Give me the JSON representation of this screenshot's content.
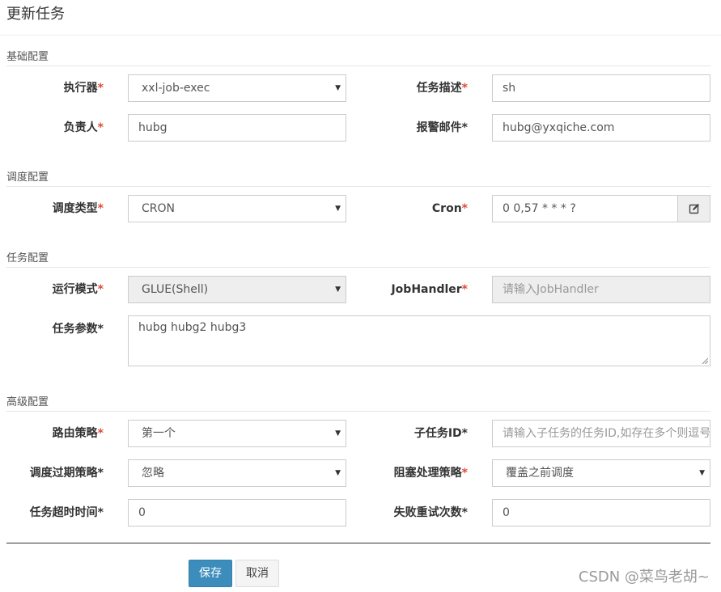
{
  "dialog": {
    "title": "更新任务"
  },
  "sections": {
    "basic": "基础配置",
    "schedule": "调度配置",
    "task": "任务配置",
    "advanced": "高级配置"
  },
  "basic": {
    "executor": {
      "label": "执行器",
      "value": "xxl-job-exec"
    },
    "job_desc": {
      "label": "任务描述",
      "value": "sh"
    },
    "author": {
      "label": "负责人",
      "value": "hubg"
    },
    "alarm_email": {
      "label": "报警邮件",
      "value": "hubg@yxqiche.com"
    }
  },
  "schedule": {
    "schedule_type": {
      "label": "调度类型",
      "value": "CRON"
    },
    "cron": {
      "label": "Cron",
      "value": "0 0,57 * * * ?"
    }
  },
  "task": {
    "glue_type": {
      "label": "运行模式",
      "value": "GLUE(Shell)"
    },
    "job_handler": {
      "label": "JobHandler",
      "placeholder": "请输入JobHandler"
    },
    "job_param": {
      "label": "任务参数",
      "value": "hubg hubg2 hubg3"
    }
  },
  "advanced": {
    "route_strategy": {
      "label": "路由策略",
      "value": "第一个"
    },
    "child_job_id": {
      "label": "子任务ID",
      "placeholder": "请输入子任务的任务ID,如存在多个则逗号"
    },
    "misfire_strategy": {
      "label": "调度过期策略",
      "value": "忽略"
    },
    "block_strategy": {
      "label": "阻塞处理策略",
      "value": "覆盖之前调度"
    },
    "timeout": {
      "label": "任务超时时间",
      "value": "0"
    },
    "fail_retry": {
      "label": "失败重试次数",
      "value": "0"
    }
  },
  "footer": {
    "save_label": "保存",
    "cancel_label": "取消"
  },
  "watermark": "CSDN @菜鸟老胡~",
  "colors": {
    "primary": "#3c8dbc",
    "required": "#dd4b39"
  }
}
